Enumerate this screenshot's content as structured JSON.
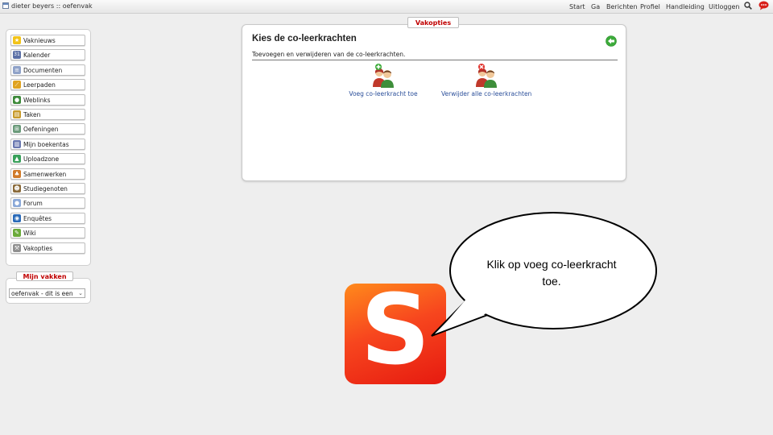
{
  "topbar": {
    "title": "dieter beyers :: oefenvak",
    "nav": [
      "Start",
      "Ga",
      "Berichten",
      "Profiel",
      "Handleiding",
      "Uitloggen"
    ]
  },
  "sidebar": {
    "items": [
      {
        "label": "Vaknieuws",
        "icon": "star-icon",
        "color": "#f2c318"
      },
      {
        "label": "Kalender",
        "icon": "calendar-icon",
        "color": "#5a6fa6"
      },
      {
        "label": "Documenten",
        "icon": "document-icon",
        "color": "#8fa2c8"
      },
      {
        "label": "Leerpaden",
        "icon": "path-icon",
        "color": "#e0a320"
      },
      {
        "label": "Weblinks",
        "icon": "globe-link-icon",
        "color": "#3d8a3a"
      },
      {
        "label": "Taken",
        "icon": "tasks-icon",
        "color": "#c79a2b"
      },
      {
        "label": "Oefeningen",
        "icon": "exercise-icon",
        "color": "#6a9a7a"
      },
      {
        "label": "Mijn boekentas",
        "icon": "bag-icon",
        "color": "#6a78b0"
      },
      {
        "label": "Uploadzone",
        "icon": "upload-icon",
        "color": "#38a05a"
      },
      {
        "label": "Samenwerken",
        "icon": "collaborate-icon",
        "color": "#d07a2a"
      },
      {
        "label": "Studiegenoten",
        "icon": "classmates-icon",
        "color": "#8a6a3a"
      },
      {
        "label": "Forum",
        "icon": "forum-icon",
        "color": "#8aa8d8"
      },
      {
        "label": "Enquêtes",
        "icon": "survey-icon",
        "color": "#2a6ab8"
      },
      {
        "label": "Wiki",
        "icon": "wiki-icon",
        "color": "#6aaa3a"
      },
      {
        "label": "Vakopties",
        "icon": "wrench-icon",
        "color": "#909090"
      }
    ]
  },
  "mijn_vakken": {
    "title": "Mijn vakken",
    "selected": "oefenvak - dit is een"
  },
  "panel": {
    "tab": "Vakopties",
    "title": "Kies de co-leerkrachten",
    "subtitle": "Toevoegen en verwijderen van de co-leerkrachten.",
    "add_label": "Voeg co-leerkracht toe",
    "remove_label": "Verwijder alle co-leerkrachten"
  },
  "balloon": {
    "text": "Klik op voeg co-leerkracht toe."
  },
  "logo": {
    "letter": "S",
    "color": "#f24a1c"
  }
}
